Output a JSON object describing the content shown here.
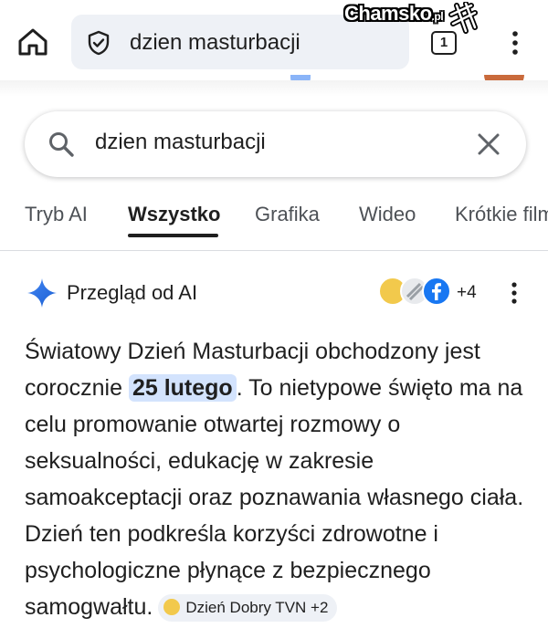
{
  "browser": {
    "url_text": "dzien masturbacji",
    "tab_count": "1"
  },
  "watermark": {
    "brand": "Chamsko",
    "suffix": ".pl"
  },
  "search": {
    "query": "dzien masturbacji"
  },
  "tabs": [
    {
      "label": "Tryb AI",
      "active": false
    },
    {
      "label": "Wszystko",
      "active": true
    },
    {
      "label": "Grafika",
      "active": false
    },
    {
      "label": "Wideo",
      "active": false
    },
    {
      "label": "Krótkie filmy",
      "active": false
    }
  ],
  "ai_overview": {
    "title": "Przegląd od AI",
    "source_count": "+4",
    "source_icon_colors": [
      "#f2c94c",
      "#9aa0a6",
      "#1877f2"
    ],
    "text_before": "Światowy Dzień Masturbacji obchodzony jest corocznie ",
    "highlight": "25 lutego",
    "text_after": ". To nietypowe święto ma na celu promowanie otwartej rozmowy o seksualności, edukację w zakresie samoakceptacji oraz poznawania własnego ciała. Dzień ten podkreśla korzyści zdrowotne i psychologiczne płynące z bezpiecznego samogwałtu.",
    "citation": "Dzień Dobry TVN +2"
  },
  "colors": {
    "accent_highlight": "#d3e3fd",
    "chip_bg": "#eef1f6",
    "spark_blue": "#4285f4"
  }
}
